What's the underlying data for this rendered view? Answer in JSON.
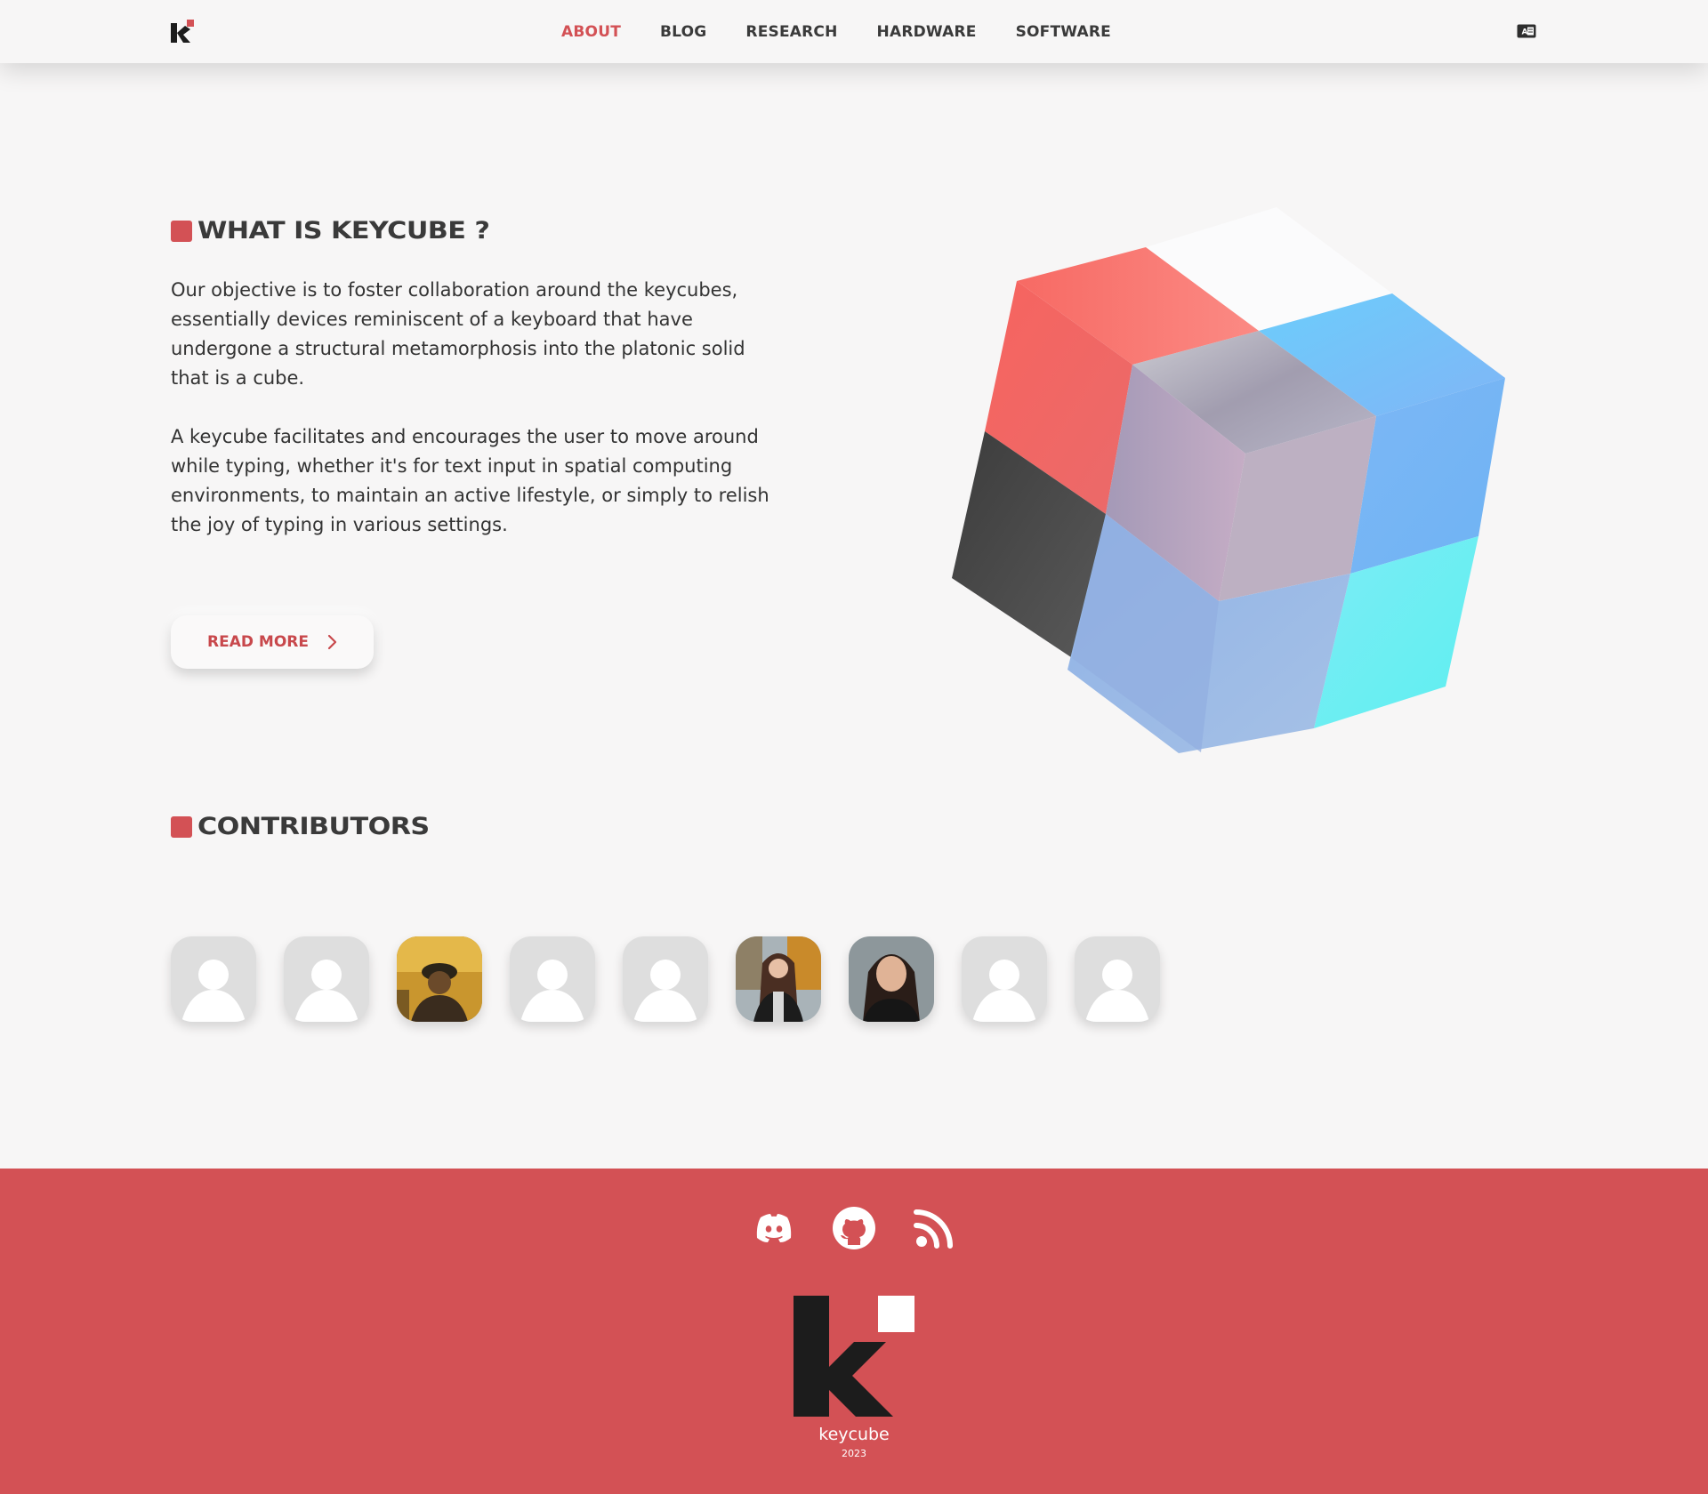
{
  "header": {
    "nav": [
      {
        "label": "ABOUT",
        "active": true
      },
      {
        "label": "BLOG",
        "active": false
      },
      {
        "label": "RESEARCH",
        "active": false
      },
      {
        "label": "HARDWARE",
        "active": false
      },
      {
        "label": "SOFTWARE",
        "active": false
      }
    ],
    "logo_icon": "keycube-logo-icon",
    "language_icon": "translate-icon"
  },
  "about": {
    "title": "WHAT IS KEYCUBE ?",
    "paragraph_1": "Our objective is to foster collaboration around the keycubes, essentially devices reminiscent of a keyboard that have undergone a structural metamorphosis into the platonic solid that is a cube.",
    "paragraph_2": "A keycube facilitates and encourages the user to move around while typing, whether it's for text input in spatial computing environments, to maintain an active lifestyle, or simply to relish the joy of typing in various settings.",
    "read_more_label": "READ MORE"
  },
  "contributors": {
    "title": "CONTRIBUTORS",
    "avatars": [
      "placeholder",
      "placeholder",
      "photo",
      "placeholder",
      "placeholder",
      "photo",
      "photo",
      "placeholder",
      "placeholder"
    ]
  },
  "footer": {
    "socials": [
      "discord-icon",
      "github-icon",
      "rss-icon"
    ],
    "brand": "keycube",
    "year": "2023"
  },
  "colors": {
    "accent": "#d35155",
    "background": "#f7f6f6",
    "text": "#3a3a3a"
  }
}
